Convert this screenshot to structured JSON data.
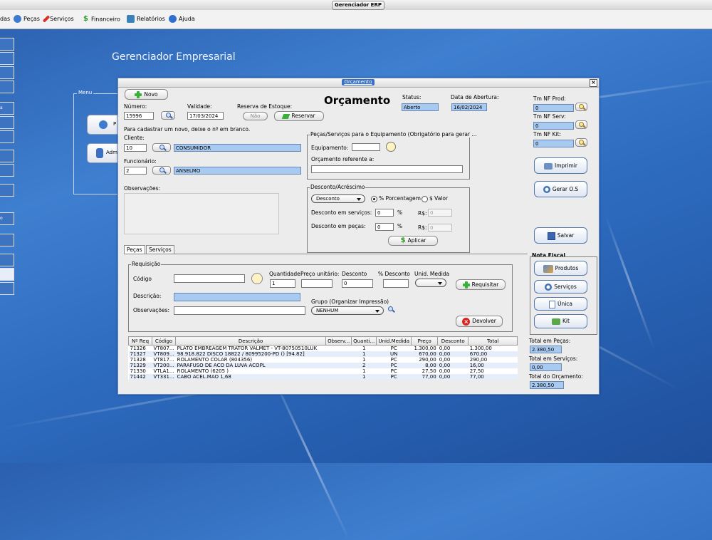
{
  "app": {
    "window_title": "Gerenciador ERP",
    "heading": "Gerenciador Empresarial"
  },
  "menubar": [
    {
      "label": "das",
      "icon": "doc-icon",
      "color": "#4a7cc0"
    },
    {
      "label": "Peças",
      "icon": "gear-icon",
      "color": "#3c7bd0"
    },
    {
      "label": "Serviços",
      "icon": "wrench-icon",
      "color": "#d8322a"
    },
    {
      "label": "Financeiro",
      "icon": "dollar-icon",
      "color": "#2f9a2a"
    },
    {
      "label": "Relatórios",
      "icon": "report-icon",
      "color": "#3a82b8"
    },
    {
      "label": "Ajuda",
      "icon": "help-icon",
      "color": "#2f6fd0"
    }
  ],
  "left_stubs": [
    "",
    "",
    "",
    "",
    "a",
    "",
    "",
    "",
    "",
    "o",
    "",
    "",
    "",
    ""
  ],
  "side_menu": {
    "label": "Menu",
    "buttons": [
      "P",
      "Adm"
    ]
  },
  "form": {
    "window_title": "Orçamento",
    "heading": "Orçamento",
    "novo": "Novo",
    "numero_label": "Número:",
    "numero": "15996",
    "validade_label": "Validade:",
    "validade": "17/03/2024",
    "reserva_label": "Reserva de Estoque:",
    "reserva_toggle": "Não",
    "reservar": "Reservar",
    "status_label": "Status:",
    "status": "Aberto",
    "abertura_label": "Data de Abertura:",
    "abertura": "16/02/2024",
    "hint": "Para cadastrar um novo, deixe o nº em branco.",
    "cliente_label": "Cliente:",
    "cliente_id": "10",
    "cliente_nome": "CONSUMIDOR",
    "funcionario_label": "Funcionário:",
    "funcionario_id": "2",
    "funcionario_nome": "ANSELMO",
    "observacoes_label": "Observações:",
    "equip_group": "Peças/Serviços para o Equipamento (Obrigatório para gerar ...",
    "equip_label": "Equipamento:",
    "orc_ref_label": "Orçamento referente a:",
    "desc_group": "Desconto/Acréscimo",
    "desc_type": "Desconto",
    "pct_label": "% Porcentagem",
    "val_label": "$ Valor",
    "desc_serv_label": "Desconto em serviços:",
    "desc_serv": "0",
    "pct_sign": "%",
    "rs_label": "R$:",
    "desc_serv_rs": "0",
    "desc_pecas_label": "Desconto em peças:",
    "desc_pecas": "0",
    "desc_pecas_rs": "0",
    "aplicar": "Aplicar",
    "tm_nf_prod_label": "Tm NF Prod:",
    "tm_nf_prod": "0",
    "tm_nf_serv_label": "Tm NF Serv:",
    "tm_nf_serv": "0",
    "tm_nf_kit_label": "Tm NF Kit:",
    "tm_nf_kit": "0",
    "imprimir": "Imprimir",
    "gerar_os": "Gerar O.S",
    "salvar": "Salvar",
    "nota_fiscal_label": "Nota Fiscal",
    "nf_buttons": [
      "Produtos",
      "Serviços",
      "Única",
      "Kit"
    ],
    "tabs": [
      "Peças",
      "Serviços"
    ],
    "req_group": "Requisição",
    "codigo_label": "Código",
    "quantidade_label": "Quantidade:",
    "quantidade": "1",
    "preco_unit_label": "Preço unitário:",
    "desconto_label": "Desconto",
    "desconto": "0",
    "pct_desc_label": "% Desconto",
    "unid_label": "Unid. Medida",
    "requisitar": "Requisitar",
    "descricao_label": "Descrição:",
    "obs_label": "Observações:",
    "grupo_label": "Grupo (Organizar Impressão)",
    "grupo": "NENHUM",
    "devolver": "Devolver",
    "columns": [
      "Nº Req",
      "Código",
      "Descrição",
      "Observ...",
      "Quanti...",
      "Unid.Medida",
      "Preço",
      "Desconto",
      "Total"
    ],
    "rows": [
      [
        "71326",
        "VT807...",
        "PLATO EMBREAGEM TRATOR VALMET - VT-80750510LUK",
        "",
        "1",
        "PC",
        "1.300,00",
        "0,00",
        "1.300,00"
      ],
      [
        "71327",
        "VT809...",
        "98.918.822 DISCO 18822 / 80995200-PD () [94.82]",
        "",
        "1",
        "UN",
        "670,00",
        "0,00",
        "670,00"
      ],
      [
        "71328",
        "VT817...",
        "ROLAMENTO COLAR  (804356)",
        "",
        "1",
        "PC",
        "290,00",
        "0,00",
        "290,00"
      ],
      [
        "71329",
        "VT200...",
        "PARAFUSO DE ACO DA LUVA  ACOPL",
        "",
        "2",
        "PC",
        "8,00",
        "0,00",
        "16,00"
      ],
      [
        "71330",
        "VTLA1...",
        "ROLAMENTO  (6205 )",
        "",
        "1",
        "PC",
        "27,50",
        "0,00",
        "27,50"
      ],
      [
        "71442",
        "VT331...",
        "CABO ACEL.MAO 1,68",
        "",
        "1",
        "PC",
        "77,00",
        "0,00",
        "77,00"
      ]
    ],
    "total_pecas_label": "Total em Peças:",
    "total_pecas": "2.380,50",
    "total_servicos_label": "Total em Serviços:",
    "total_servicos": "0,00",
    "total_orcamento_label": "Total do Orçamento:",
    "total_orcamento": "2.380,50"
  }
}
